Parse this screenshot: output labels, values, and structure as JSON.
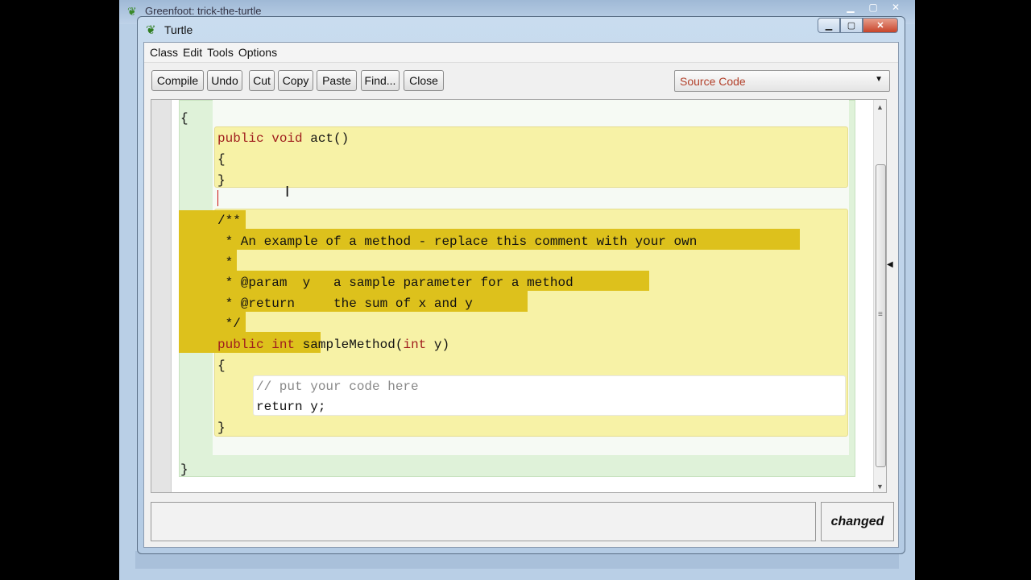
{
  "background_window": {
    "title": "Greenfoot: trick-the-turtle"
  },
  "window": {
    "title": "Turtle"
  },
  "menu": [
    "Class",
    "Edit",
    "Tools",
    "Options"
  ],
  "toolbar": {
    "compile": "Compile",
    "undo": "Undo",
    "cut": "Cut",
    "copy": "Copy",
    "paste": "Paste",
    "find": "Find...",
    "close": "Close",
    "view_select": "Source Code"
  },
  "code": {
    "open_brace": "{",
    "act_kw": "public void",
    "act_name": " act()",
    "act_open": "{",
    "act_close": "}",
    "doc_open": "/**",
    "doc_line1": " * An example of a method - replace this comment with your own",
    "doc_line2": " *",
    "doc_line3": " * @param  y   a sample parameter for a method",
    "doc_line4": " * @return     the sum of x and y",
    "doc_close": " */",
    "sample_kw1": "public",
    "sample_kw2": "int",
    "sample_rest": "sampleMethod(",
    "sample_kw3": "int",
    "sample_end": " y)",
    "sample_open": "{",
    "comment": "// put your code here",
    "return_stmt": "return y;",
    "sample_close": "}",
    "class_close": "}"
  },
  "status": "changed"
}
